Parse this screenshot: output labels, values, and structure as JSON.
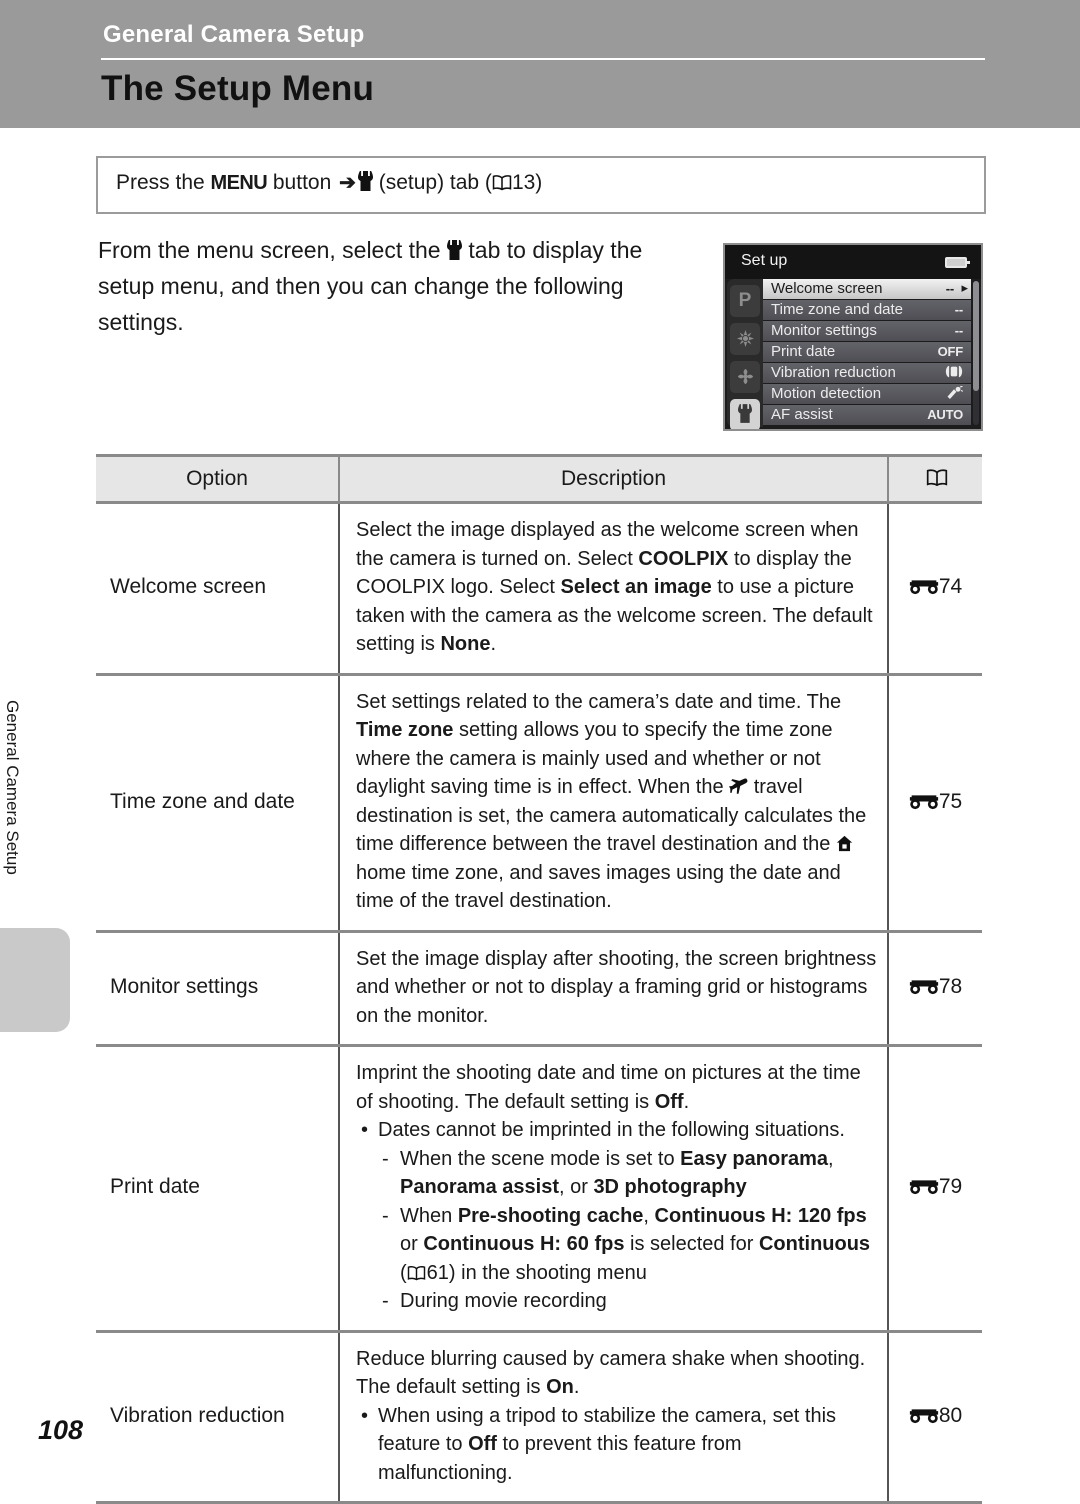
{
  "header": {
    "chapter": "General Camera Setup",
    "title": "The Setup Menu"
  },
  "side_tab": {
    "label": "General Camera Setup"
  },
  "instruction": {
    "prefix": "Press the ",
    "menu_button": "MENU",
    "mid": " button ",
    "arrow": "➔",
    "suffix": " (setup) tab (",
    "page_ref": "13",
    "close": ")"
  },
  "intro": {
    "part1": "From the menu screen, select the ",
    "part2": " tab to display the setup menu, and then you can change the following settings."
  },
  "lcd": {
    "title": "Set up",
    "battery_icon": "battery-icon",
    "tabs": [
      {
        "name": "tab-shooting-p",
        "label": "P",
        "active": false
      },
      {
        "name": "tab-scene",
        "label": "",
        "active": false
      },
      {
        "name": "tab-effects",
        "label": "",
        "active": false
      },
      {
        "name": "tab-setup",
        "label": "",
        "active": true
      }
    ],
    "rows": [
      {
        "label": "Welcome screen",
        "value": "--",
        "selected": true
      },
      {
        "label": "Time zone and date",
        "value": "--",
        "selected": false
      },
      {
        "label": "Monitor settings",
        "value": "--",
        "selected": false
      },
      {
        "label": "Print date",
        "value": "OFF",
        "selected": false
      },
      {
        "label": "Vibration reduction",
        "value": "",
        "selected": false
      },
      {
        "label": "Motion detection",
        "value": "",
        "selected": false
      },
      {
        "label": "AF assist",
        "value": "AUTO",
        "selected": false
      }
    ]
  },
  "table": {
    "headers": {
      "option": "Option",
      "description": "Description",
      "reference": "book-icon"
    },
    "rows": [
      {
        "option": "Welcome screen",
        "ref": "74",
        "description_plain": "Select the image displayed as the welcome screen when the camera is turned on. Select COOLPIX to display the COOLPIX logo. Select Select an image to use a picture taken with the camera as the welcome screen. The default setting is None."
      },
      {
        "option": "Time zone and date",
        "ref": "75",
        "description_plain": "Set settings related to the camera's date and time. The Time zone setting allows you to specify the time zone where the camera is mainly used and whether or not daylight saving time is in effect. When the ✈ travel destination is set, the camera automatically calculates the time difference between the travel destination and the ⌂ home time zone, and saves images using the date and time of the travel destination."
      },
      {
        "option": "Monitor settings",
        "ref": "78",
        "description_plain": "Set the image display after shooting, the screen brightness and whether or not to display a framing grid or histograms on the monitor."
      },
      {
        "option": "Print date",
        "ref": "79",
        "description_plain": "Imprint the shooting date and time on pictures at the time of shooting. The default setting is Off. • Dates cannot be imprinted in the following situations. - When the scene mode is set to Easy panorama, Panorama assist, or 3D photography - When Pre-shooting cache, Continuous H: 120 fps or Continuous H: 60 fps is selected for Continuous (61) in the shooting menu - During movie recording"
      },
      {
        "option": "Vibration reduction",
        "ref": "80",
        "description_plain": "Reduce blurring caused by camera shake when shooting. The default setting is On. • When using a tripod to stabilize the camera, set this feature to Off to prevent this feature from malfunctioning."
      }
    ],
    "row1": {
      "s1": "Select the image displayed as the welcome screen when the camera is turned on. Select ",
      "b1": "COOLPIX",
      "s2": " to display the COOLPIX logo. Select ",
      "b2": "Select an image",
      "s3": " to use a picture taken with the camera as the welcome screen. The default setting is ",
      "b3": "None",
      "s4": "."
    },
    "row2": {
      "s1": "Set settings related to the camera’s date and time. The ",
      "b1": "Time zone",
      "s2": " setting allows you to specify the time zone where the camera is mainly used and whether or not daylight saving time is in effect. When the ",
      "s3": " travel destination is set, the camera automatically calculates the time difference between the travel destination and the ",
      "s4": " home time zone, and saves images using the date and time of the travel destination."
    },
    "row3": {
      "s1": "Set the image display after shooting, the screen brightness and whether or not to display a framing grid or histograms on the monitor."
    },
    "row4": {
      "s1": "Imprint the shooting date and time on pictures at the time of shooting. The default setting is ",
      "b1": "Off",
      "s2": ".",
      "bullet1": "Dates cannot be imprinted in the following situations.",
      "d1a": "When the scene mode is set to ",
      "d1b": "Easy panorama",
      "d1c": ", ",
      "d1d": "Panorama assist",
      "d1e": ", or ",
      "d1f": "3D photography",
      "d2a": "When ",
      "d2b": "Pre-shooting cache",
      "d2c": ", ",
      "d2d": "Continuous H: 120 fps",
      "d2e": " or ",
      "d2f": "Continuous H: 60 fps",
      "d2g": " is selected for ",
      "d2h": "Continuous",
      "d2i": " (",
      "d2j": "61",
      "d2k": ") in the shooting menu",
      "d3": "During movie recording"
    },
    "row5": {
      "s1": "Reduce blurring caused by camera shake when shooting. The default setting is ",
      "b1": "On",
      "s2": ".",
      "bullet1a": "When using a tripod to stabilize the camera, set this feature to ",
      "bullet1b": "Off",
      "bullet1c": " to prevent this feature from malfunctioning."
    }
  },
  "footer": {
    "page_number": "108"
  },
  "colors": {
    "header_band": "#9a9a9a",
    "table_header_bg": "#e6e6e6",
    "rule": "#8a8a8a",
    "lcd_bg": "#1c1c1c"
  }
}
